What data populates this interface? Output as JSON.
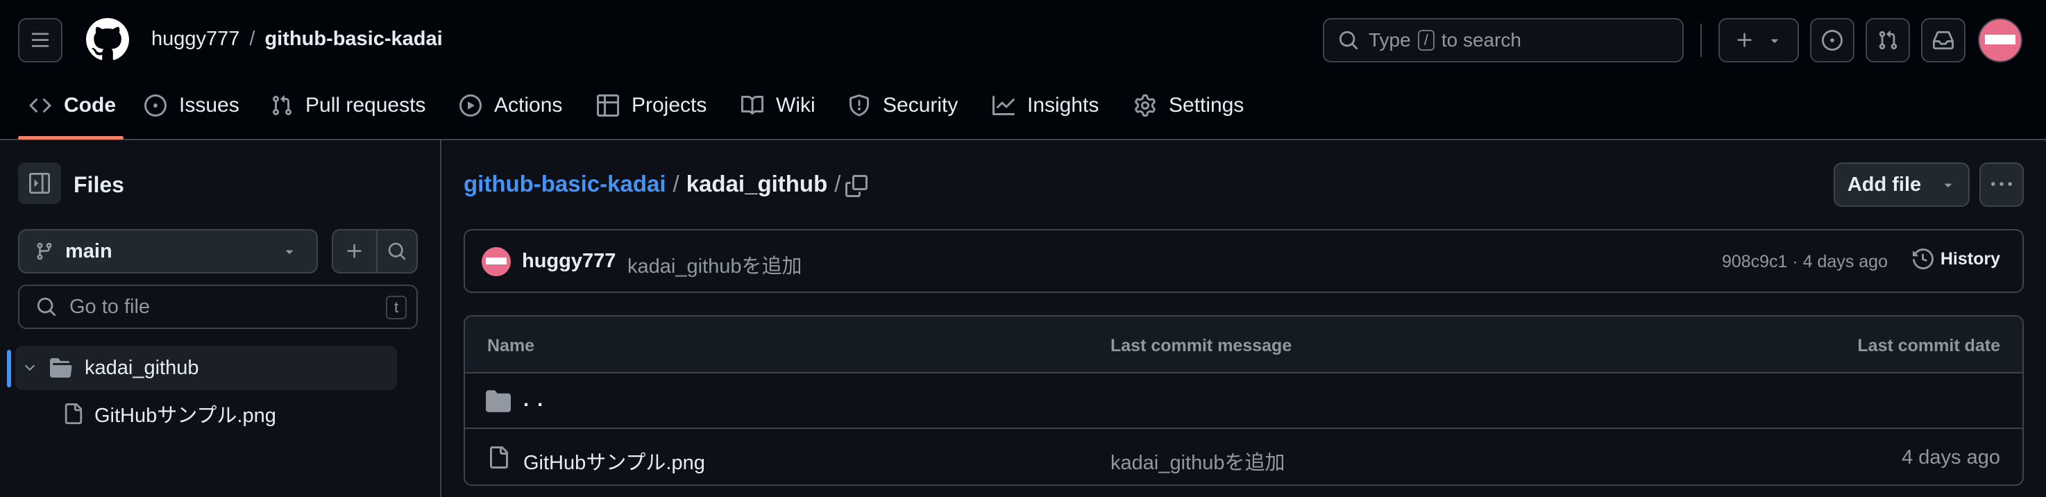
{
  "header": {
    "owner": "huggy777",
    "separator": "/",
    "repo": "github-basic-kadai",
    "search_prefix": "Type",
    "search_key": "/",
    "search_suffix": "to search"
  },
  "repo_nav": [
    {
      "label": "Code",
      "icon": "code-icon"
    },
    {
      "label": "Issues",
      "icon": "issue-icon"
    },
    {
      "label": "Pull requests",
      "icon": "pull-request-icon"
    },
    {
      "label": "Actions",
      "icon": "play-icon"
    },
    {
      "label": "Projects",
      "icon": "table-icon"
    },
    {
      "label": "Wiki",
      "icon": "book-icon"
    },
    {
      "label": "Security",
      "icon": "shield-icon"
    },
    {
      "label": "Insights",
      "icon": "graph-icon"
    },
    {
      "label": "Settings",
      "icon": "gear-icon"
    }
  ],
  "sidebar": {
    "title": "Files",
    "branch": "main",
    "goto_placeholder": "Go to file",
    "goto_shortcut": "t",
    "tree": [
      {
        "name": "kadai_github",
        "type": "folder",
        "expanded": true
      },
      {
        "name": "GitHubサンプル.png",
        "type": "file"
      }
    ]
  },
  "breadcrumb": {
    "repo": "github-basic-kadai",
    "sep1": "/",
    "folder": "kadai_github",
    "sep2": "/"
  },
  "actions": {
    "add_file": "Add file"
  },
  "commit": {
    "author": "huggy777",
    "message": "kadai_githubを追加",
    "hash_age": "908c9c1 · 4 days ago",
    "history": "History"
  },
  "table": {
    "headers": {
      "name": "Name",
      "message": "Last commit message",
      "date": "Last commit date"
    },
    "parent": ". .",
    "rows": [
      {
        "name": "GitHubサンプル.png",
        "message": "kadai_githubを追加",
        "date": "4 days ago"
      }
    ]
  },
  "colors": {
    "accent_link": "#4493f8",
    "tab_underline": "#f78166",
    "selected_bar": "#4493f8",
    "avatar": "#e86d8a"
  }
}
